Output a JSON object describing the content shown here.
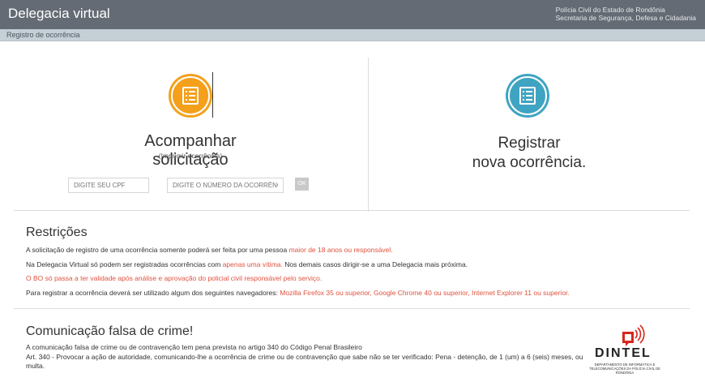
{
  "header": {
    "title": "Delegacia virtual",
    "org_line1": "Polícia Civil do Estado de Rondônia",
    "org_line2": "Secretaria de Segurança, Defesa e Cidadania"
  },
  "breadcrumb": "Registro de ocorrência",
  "colors": {
    "orange": "#f4a01b",
    "blue": "#3fa4c2",
    "header": "#646b74",
    "accent_red": "#e0523e"
  },
  "acompanhar": {
    "icon": "document-list-icon",
    "title": "Acompanhar solicitação",
    "subtitle": "(Imprimir ocorrência)",
    "cpf_placeholder": "DIGITE SEU CPF",
    "numero_placeholder": "DIGITE O NÚMERO DA OCORRÊNCIA",
    "ok_label": "OK"
  },
  "registrar": {
    "icon": "document-list-icon",
    "title_line1": "Registrar",
    "title_line2": "nova ocorrência."
  },
  "restricoes": {
    "title": "Restrições",
    "line1_a": "A solicitação de registro de uma ocorrência somente poderá ser feita por uma pessoa ",
    "line1_b": "maior de 18 anos ou responsável.",
    "line2_a": "Na Delegacia Virtual só podem ser registradas ocorrências com ",
    "line2_b": "apenas uma vítima.",
    "line2_c": " Nos demais casos dirigir-se a uma Delegacia mais próxima.",
    "line3": "O BO só passa a ter validade após análise e aprovação do policial civil responsável pelo serviço.",
    "line4_a": "Para registrar a ocorrência deverá ser utilizado algum dos seguintes navegadores: ",
    "line4_b": "Mozilla Firefox 35 ou superior, Google Chrome 40 ou superior, Internet Explorer 11 ou superior."
  },
  "comunicacao": {
    "title": "Comunicação falsa de crime!",
    "line1": "A comunicação falsa de crime ou de contravenção tem pena prevista no artigo 340 do Código Penal Brasileiro",
    "line2": "Art. 340 - Provocar a ação de autoridade, comunicando-lhe a ocorrência de crime ou de contravenção que sabe não se ter verificado: Pena - detenção, de 1 (um) a 6 (seis) meses, ou multa."
  },
  "logo": {
    "word": "DINTEL",
    "subtitle": "DEPARTAMENTO DE INFORMÁTICA E TELECOMUNICAÇÕES DA POLÍCIA CIVIL DE RONDÔNIA"
  }
}
